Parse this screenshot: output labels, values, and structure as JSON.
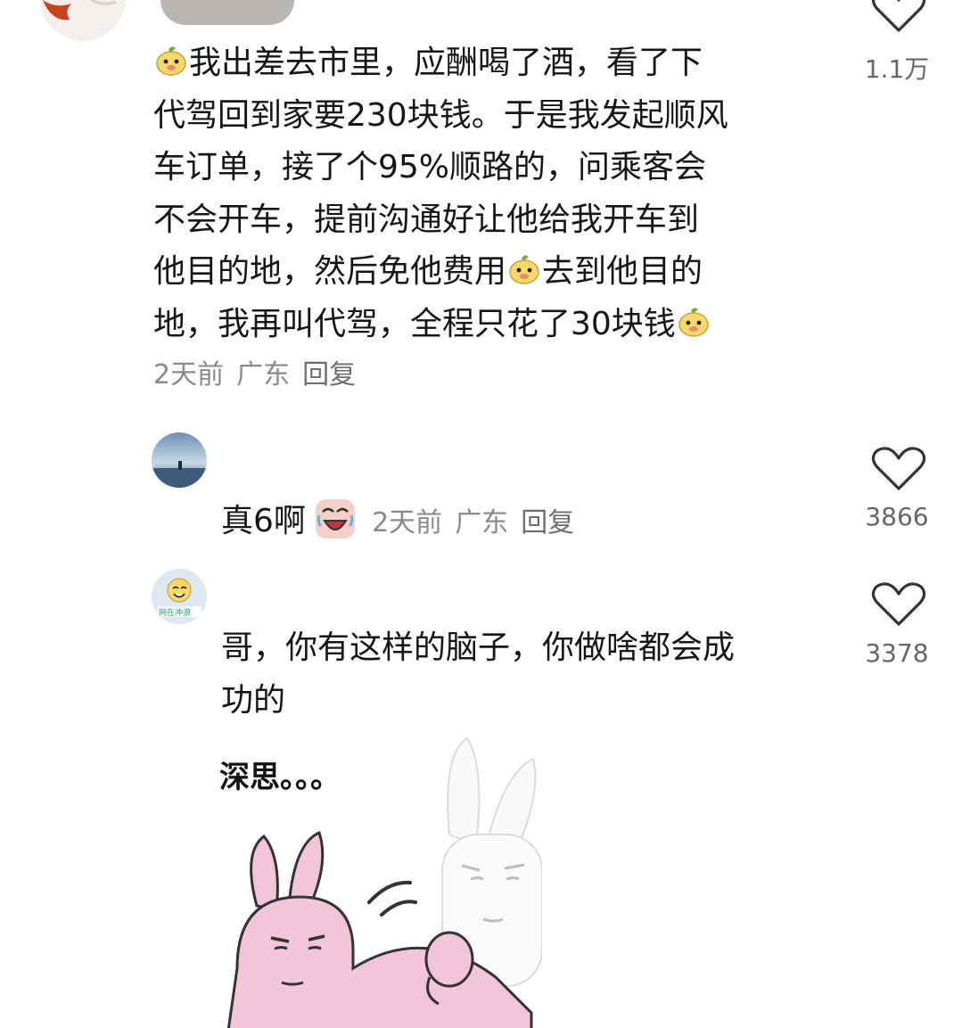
{
  "comments": [
    {
      "text_lines": [
        "我出差去市里，应酬喝了酒，看了下",
        "代驾回到家要230块钱。于是我发起顺风",
        "车订单，接了个95%顺路的，问乘客会",
        "不会开车，提前沟通好让他给我开车到",
        "他目的地，然后免他费用",
        "去到他目的",
        "地，我再叫代驾，全程只花了30块钱"
      ],
      "time": "2天前",
      "location": "广东",
      "reply_label": "回复",
      "likes": "1.1万"
    },
    {
      "text": "真6啊",
      "time": "2天前",
      "location": "广东",
      "reply_label": "回复",
      "likes": "3866"
    },
    {
      "avatar_text": "网在冲浪",
      "text_line1": "哥，你有这样的脑子，你做啥都会成",
      "text_line2": "功的",
      "sticker_caption": "深思。。。",
      "likes": "3378"
    }
  ],
  "colors": {
    "text": "#161616",
    "meta": "#8a8a8a",
    "bunny_pink": "#f2c6d8",
    "emoji_yellow": "#f7d86a"
  },
  "icons": [
    "heart-outline-icon",
    "bean-face-emoji",
    "laughing-cry-emoji"
  ]
}
